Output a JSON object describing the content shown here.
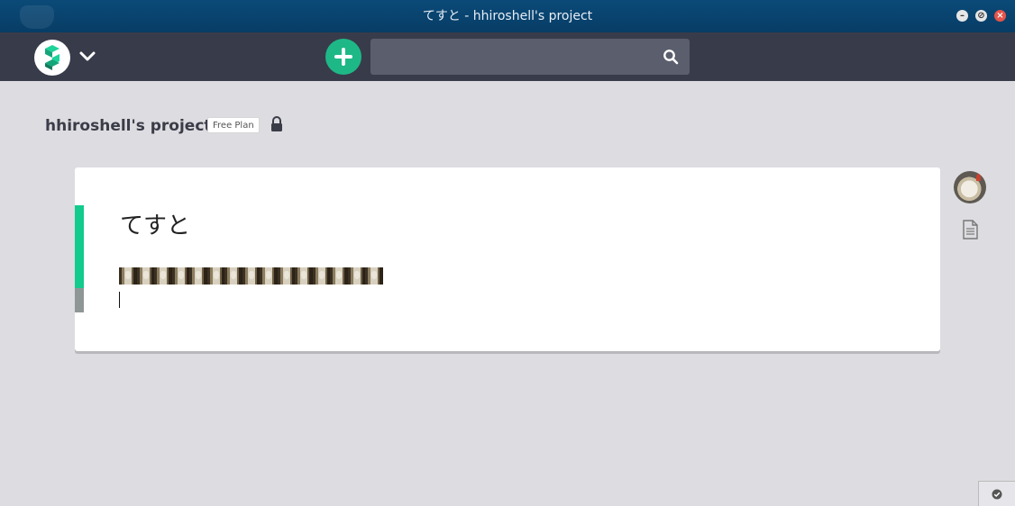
{
  "window": {
    "title": "てすと - hhiroshell's project",
    "controls": [
      "minimize-icon",
      "restore-icon",
      "close-icon"
    ]
  },
  "header": {
    "logo": "app-logo",
    "menu_icon": "chevron-down-icon",
    "add_icon": "plus-icon",
    "search": {
      "value": "",
      "placeholder": "",
      "icon": "search-icon"
    }
  },
  "project": {
    "name": "hhiroshell's project",
    "plan": "Free Plan",
    "lock_icon": "lock-icon"
  },
  "note": {
    "title": "てすと",
    "emoji_count": 15,
    "emoji_icon": "alpaca-emoji"
  },
  "sidebar": {
    "avatar": "user-avatar",
    "doc_icon": "document-icon"
  },
  "colors": {
    "titlebar": "#0b4a78",
    "appbar": "#383b4a",
    "accent": "#1eb887",
    "note_bar_green": "#12cb8c",
    "note_bar_gray": "#8f9696",
    "background": "#dddce0"
  }
}
